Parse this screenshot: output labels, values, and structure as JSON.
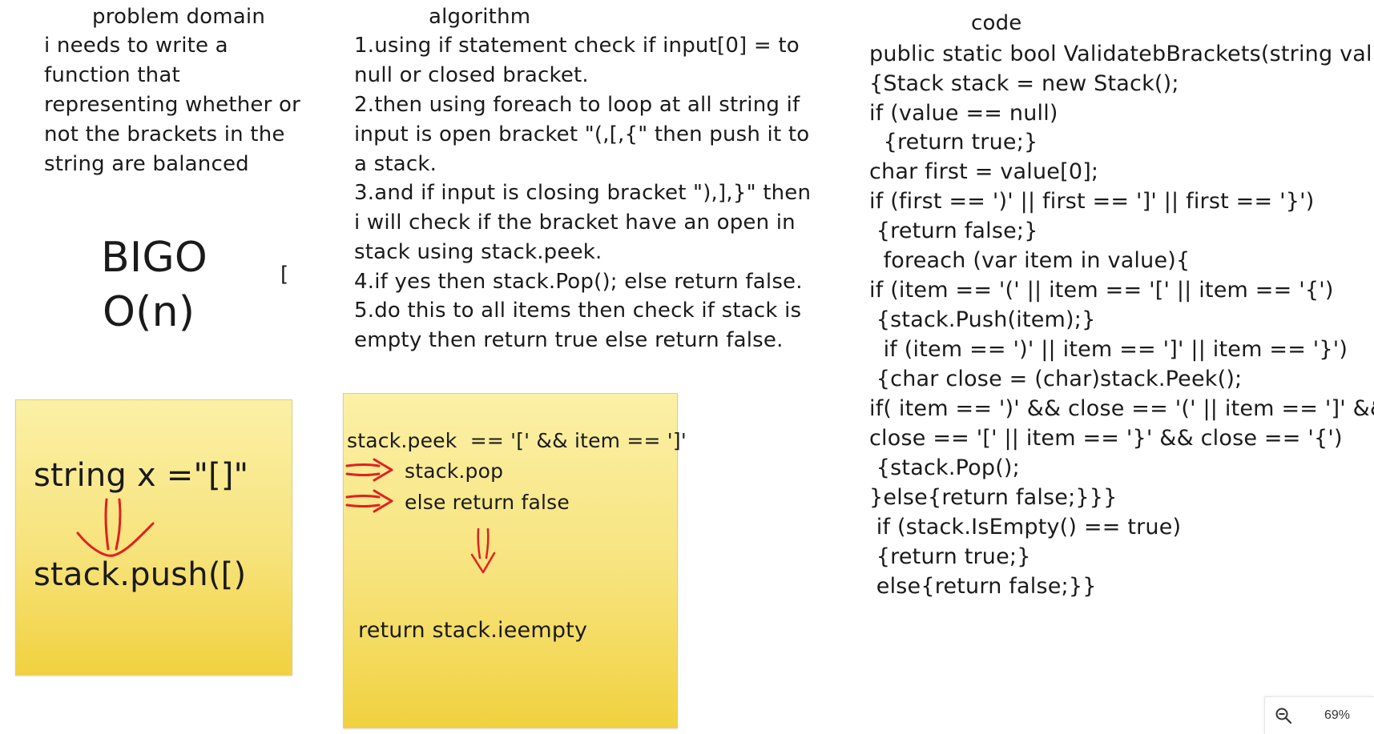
{
  "problem": {
    "heading": "problem domain",
    "lines": [
      "i needs to write a",
      "function that",
      "representing whether or",
      "not the brackets in the",
      "string are balanced"
    ]
  },
  "bigo": {
    "label": "BIGO",
    "value": "O(n)",
    "stray": "["
  },
  "algorithm": {
    "heading": "algorithm",
    "lines": [
      "1.using if statement check if input[0] = to",
      "null or closed bracket.",
      "2.then using foreach to loop at all string if",
      "input is open bracket \"(,[,{\" then push it to",
      "a stack.",
      "3.and if input is closing bracket \"),],}\" then",
      "i will check if the bracket have an open in",
      "stack using stack.peek.",
      "4.if yes then stack.Pop(); else return false.",
      "5.do this to all items then check if stack is",
      "empty then return true else return false."
    ]
  },
  "code": {
    "heading": "code",
    "lines": [
      "public static bool ValidatebBrackets(string value)",
      "{Stack stack = new Stack();",
      "if (value == null)",
      "  {return true;}",
      "char first = value[0];",
      "if (first == ')' || first == ']' || first == '}')",
      " {return false;}",
      "  foreach (var item in value){",
      "if (item == '(' || item == '[' || item == '{')",
      " {stack.Push(item);}",
      "  if (item == ')' || item == ']' || item == '}')",
      " {char close = (char)stack.Peek();",
      "if( item == ')' && close == '(' || item == ']' &&",
      "close == '[' || item == '}' && close == '{')",
      " {stack.Pop();",
      "}else{return false;}}}",
      " if (stack.IsEmpty() == true)",
      " {return true;}",
      " else{return false;}}"
    ]
  },
  "note1": {
    "line1": "string x =\"[]\"",
    "line2": "stack.push([)"
  },
  "note2": {
    "line1": "stack.peek  == '[' && item == ']'",
    "line2": "stack.pop",
    "line3": "else return false",
    "line4": "return stack.ieempty"
  },
  "zoom": {
    "level": "69%",
    "icon": "zoom-out-icon"
  },
  "colors": {
    "sticky_top": "#fbf0a6",
    "sticky_bottom": "#f1d13f",
    "annotation_red": "#e02020",
    "ink": "#1a1a1a"
  }
}
